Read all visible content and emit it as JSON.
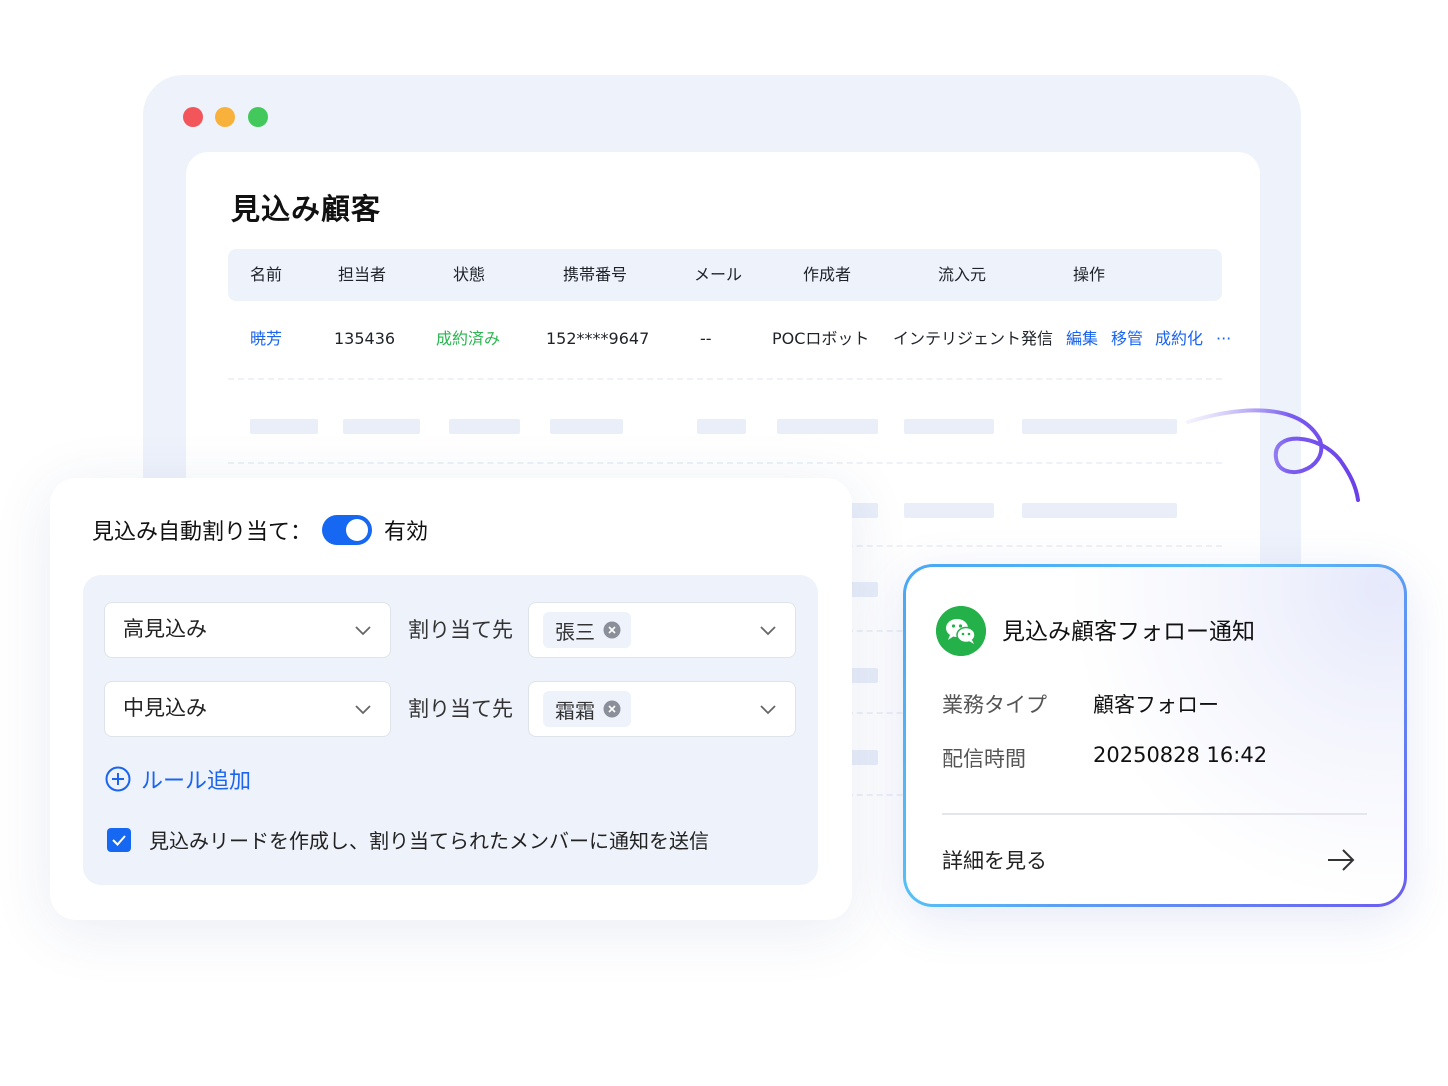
{
  "window": {
    "title": "見込み顧客"
  },
  "table": {
    "headers": [
      "名前",
      "担当者",
      "状態",
      "携帯番号",
      "メール",
      "作成者",
      "流入元",
      "操作"
    ],
    "row": {
      "name": "暁芳",
      "owner": "135436",
      "status": "成約済み",
      "phone": "152****9647",
      "email": "--",
      "creator": "POCロボット",
      "source": "インテリジェント発信",
      "actions": [
        "編集",
        "移管",
        "成約化",
        "···"
      ]
    }
  },
  "assign": {
    "title": "見込み自動割り当て：",
    "toggle_label": "有効",
    "toggle_on": true,
    "rules": [
      {
        "level": "高見込み",
        "assign_to_label": "割り当て先",
        "assignee": "張三"
      },
      {
        "level": "中見込み",
        "assign_to_label": "割り当て先",
        "assignee": "霜霜"
      }
    ],
    "add_rule": "ルール追加",
    "notify_checkbox_label": "見込みリードを作成し、割り当てられたメンバーに通知を送信",
    "notify_checked": true
  },
  "notification": {
    "title": "見込み顧客フォロー通知",
    "type_key": "業務タイプ",
    "type_value": "顧客フォロー",
    "time_key": "配信時間",
    "time_value": "20250828 16:42",
    "detail_link": "詳細を見る"
  },
  "colors": {
    "accent": "#1667f2",
    "status_success": "#2ab650",
    "wechat_green": "#24b14a",
    "window_bg": "#eef2fb"
  }
}
